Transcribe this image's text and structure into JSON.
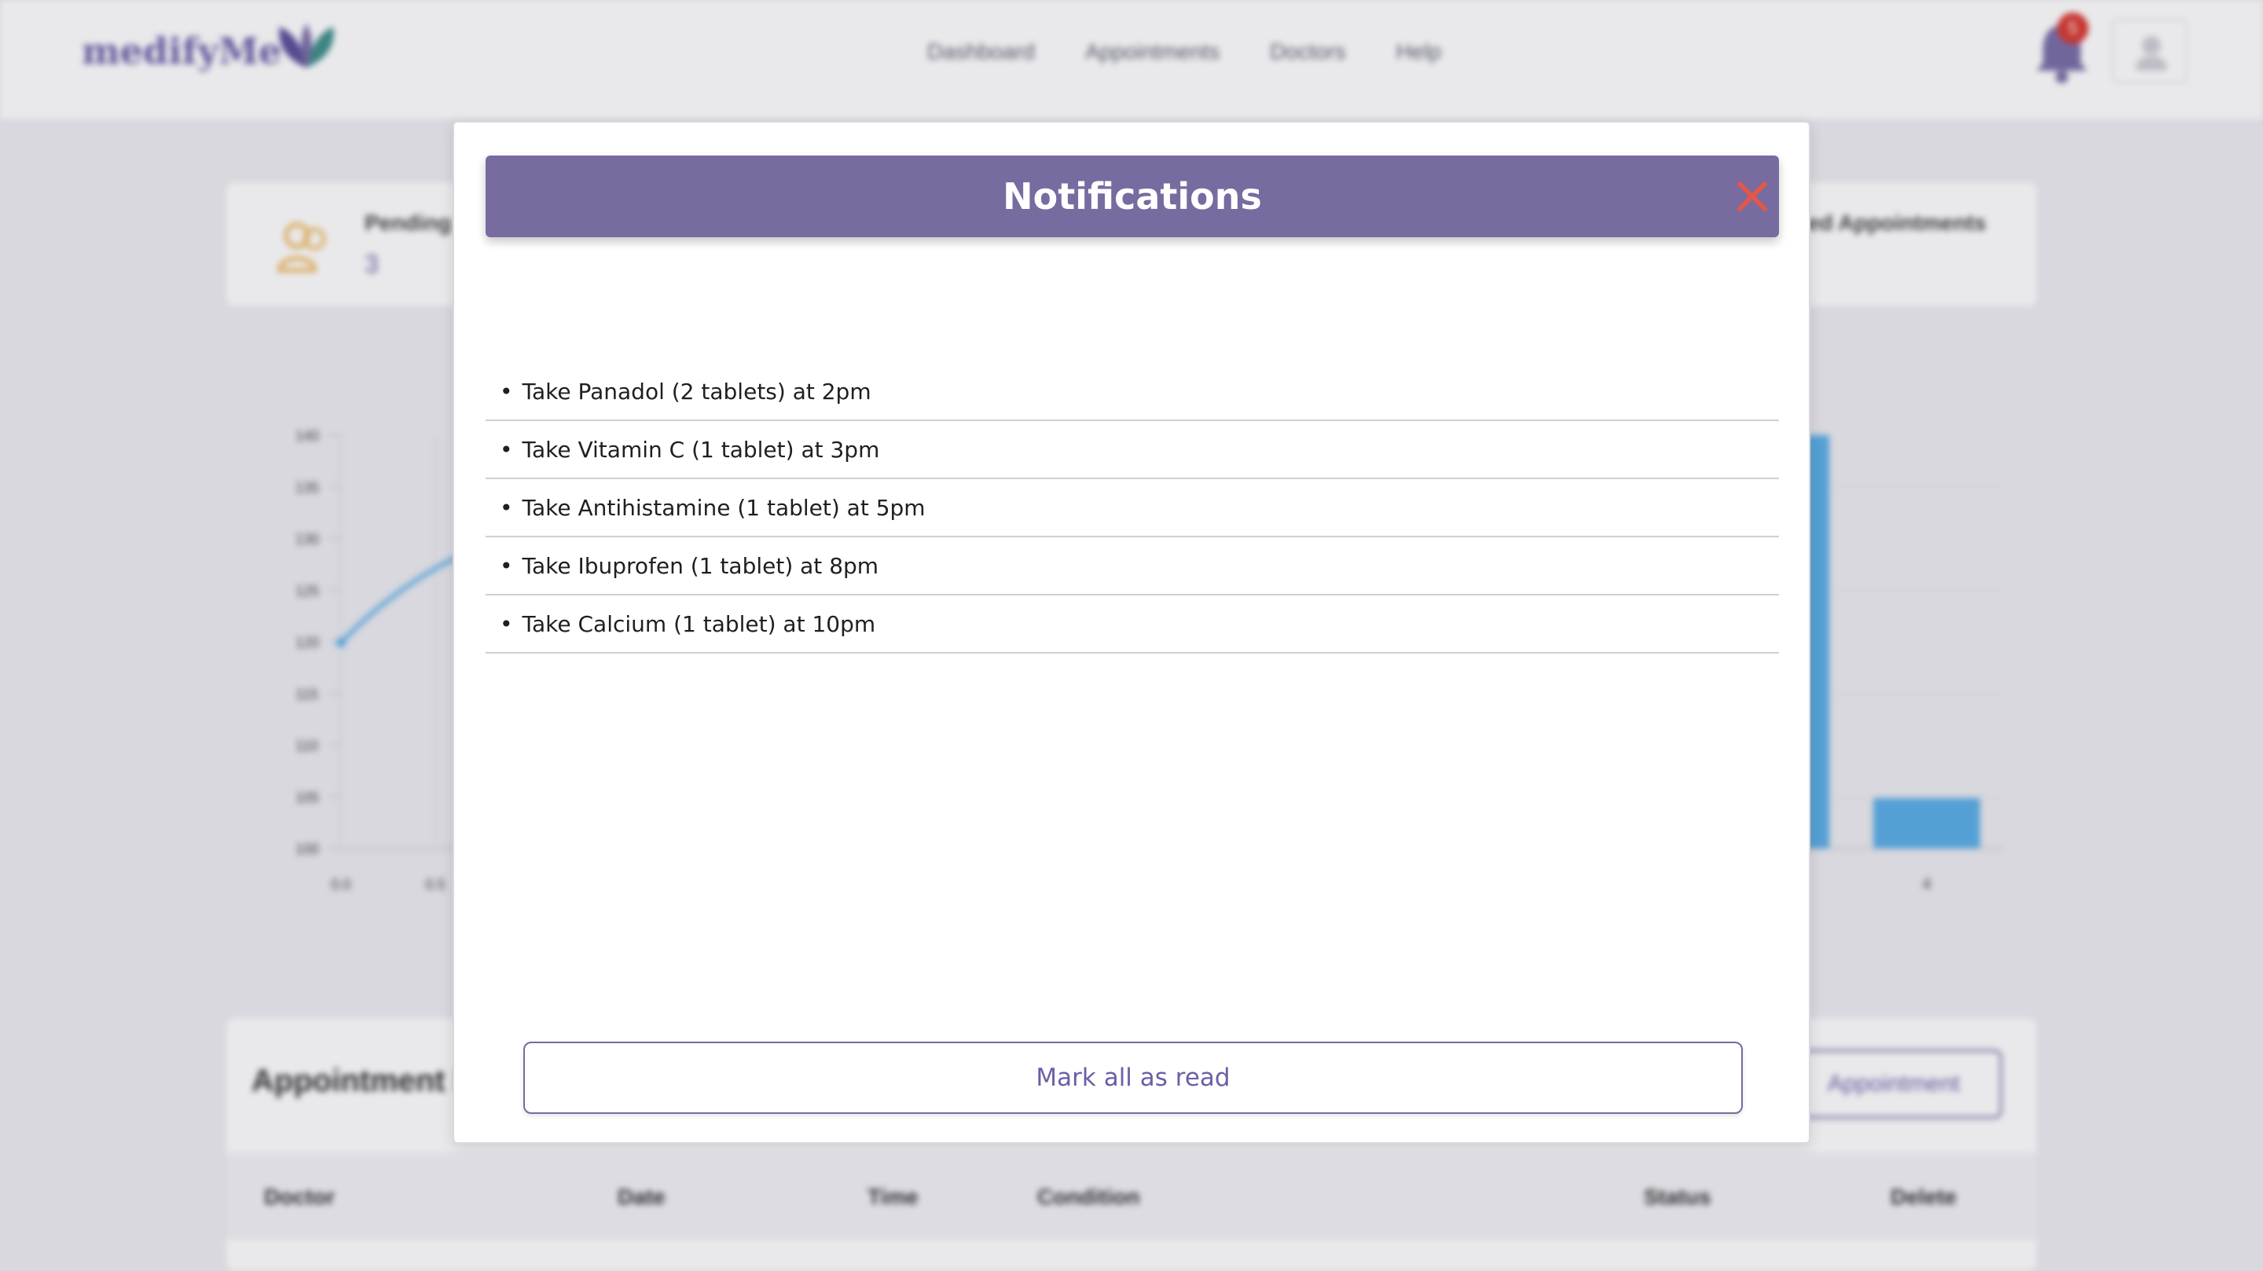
{
  "app": {
    "logo_text": "medifyMe",
    "nav": [
      "Dashboard",
      "Appointments",
      "Doctors",
      "Help"
    ],
    "notification_count": "5"
  },
  "stats": {
    "pending_label": "Pending A",
    "pending_value": "3",
    "right_label": "ed Appointments"
  },
  "chart_line": {
    "y_ticks": [
      "140",
      "135",
      "130",
      "125",
      "120",
      "115",
      "110",
      "105",
      "100"
    ],
    "x_ticks": [
      "0.0",
      "0.5"
    ]
  },
  "chart_bar": {
    "x_ticks": [
      "4"
    ]
  },
  "appointments": {
    "title": "Appointment D",
    "add_button": "Appointment",
    "columns": [
      "Doctor",
      "Date",
      "Time",
      "Condition",
      "Status",
      "Delete"
    ]
  },
  "modal": {
    "title": "Notifications",
    "items": [
      "Take Panadol (2 tablets) at 2pm",
      "Take Vitamin C (1 tablet) at 3pm",
      "Take Antihistamine (1 tablet) at 5pm",
      "Take Ibuprofen (1 tablet) at 8pm",
      "Take Calcium (1 tablet) at 10pm"
    ],
    "mark_all_label": "Mark all as read"
  },
  "colors": {
    "brand": "#776ba0",
    "close": "#e0584c",
    "badge": "#d9382f",
    "chart": "#5aaee6"
  }
}
